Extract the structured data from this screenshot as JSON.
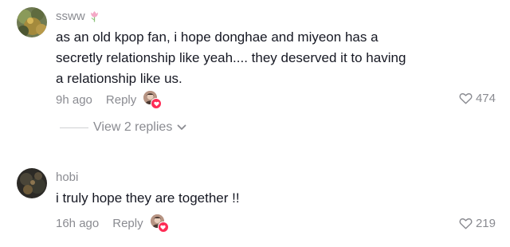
{
  "comments": [
    {
      "username": "ssww",
      "username_badge_icon": "tulip-emoji",
      "text_lines": [
        "as an old kpop fan, i hope donghae and miyeon has a",
        "secretly relationship like yeah.... they deserved it to having",
        "a relationship like us."
      ],
      "time": "9h ago",
      "reply_label": "Reply",
      "likes": "474",
      "replies_label": "View 2 replies"
    },
    {
      "username": "hobi",
      "text_lines": [
        "i truly hope they are together !!"
      ],
      "time": "16h ago",
      "reply_label": "Reply",
      "likes": "219"
    }
  ],
  "colors": {
    "text": "#161823",
    "muted": "#8a8b91",
    "heart_badge": "#fe2c55",
    "divider": "#d0d1d3"
  },
  "icons": {
    "like": "heart-outline-icon",
    "expand": "chevron-down-icon",
    "creator_liked": "creator-liked-heart-icon"
  }
}
